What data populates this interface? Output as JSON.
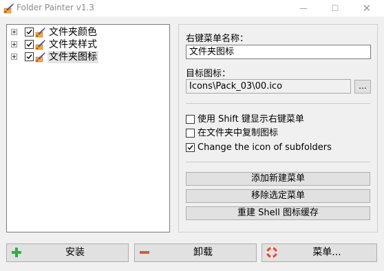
{
  "window": {
    "title": "Folder Painter v1.3",
    "controls": {
      "minimize": "—",
      "maximize": "☐",
      "close": "✕"
    }
  },
  "tree": {
    "items": [
      {
        "label": "文件夹颜色",
        "checked": true,
        "selected": false
      },
      {
        "label": "文件夹样式",
        "checked": true,
        "selected": false
      },
      {
        "label": "文件夹图标",
        "checked": true,
        "selected": true
      }
    ]
  },
  "panel": {
    "menu_name_label": "右键菜单名称：",
    "menu_name_value": "文件夹图标",
    "target_icon_label": "目标图标：",
    "target_icon_value": "Icons\\Pack_03\\00.ico",
    "browse_label": "...",
    "options": [
      {
        "label": "使用 Shift 键显示右键菜单",
        "checked": false
      },
      {
        "label": "在文件夹中复制图标",
        "checked": false
      },
      {
        "label": "Change the icon of subfolders",
        "checked": true
      }
    ],
    "buttons": {
      "add_menu": "添加新建菜单",
      "remove_menu": "移除选定菜单",
      "rebuild_cache": "重建 Shell 图标缓存"
    }
  },
  "bottom": {
    "install": "安装",
    "uninstall": "卸载",
    "menu": "菜单..."
  },
  "colors": {
    "install_icon": "#3aa845",
    "uninstall_icon": "#d9534f",
    "menu_icon": "#e8452b"
  }
}
